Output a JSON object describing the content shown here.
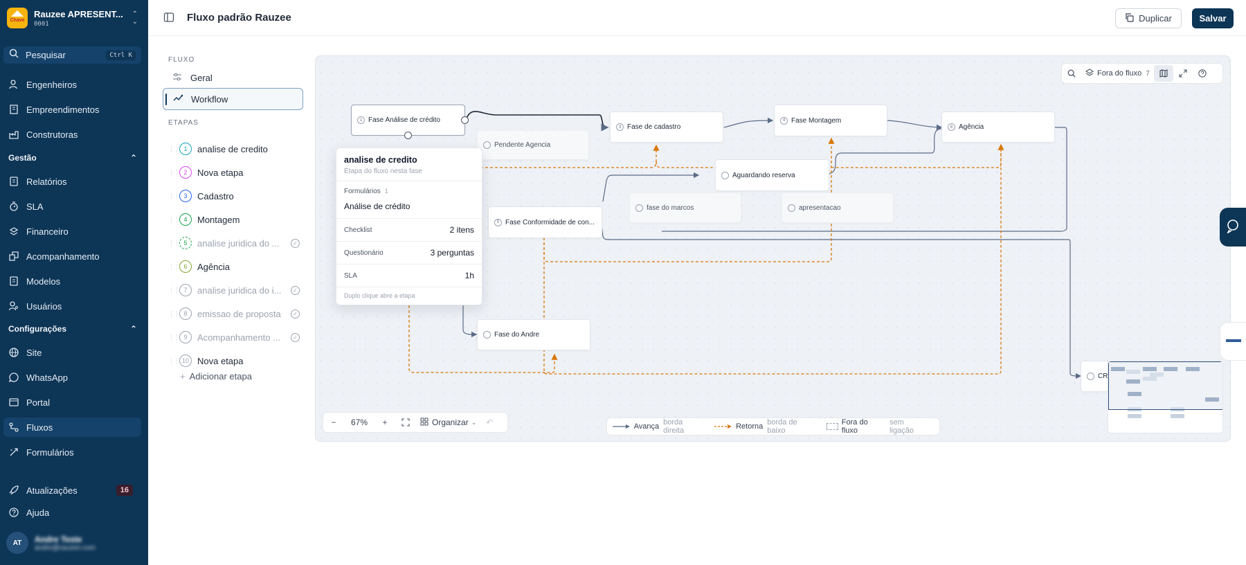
{
  "org": {
    "name": "Rauzee APRESENT...",
    "code": "0001",
    "logo_text": "Chave",
    "logo_color": "#f6b40e"
  },
  "search": {
    "label": "Pesquisar",
    "shortcut": "Ctrl K"
  },
  "nav": {
    "items_top": [
      {
        "label": "Engenheiros",
        "icon": "user-gear-icon"
      },
      {
        "label": "Empreendimentos",
        "icon": "building-icon"
      },
      {
        "label": "Construtoras",
        "icon": "factory-icon"
      }
    ],
    "gestao": {
      "title": "Gestão",
      "items": [
        {
          "label": "Relatórios",
          "icon": "report-icon"
        },
        {
          "label": "SLA",
          "icon": "timer-icon"
        },
        {
          "label": "Financeiro",
          "icon": "money-icon"
        },
        {
          "label": "Acompanhamento",
          "icon": "tracking-icon"
        },
        {
          "label": "Modelos",
          "icon": "document-icon"
        },
        {
          "label": "Usuários",
          "icon": "users-icon"
        }
      ]
    },
    "config": {
      "title": "Configurações",
      "items": [
        {
          "label": "Site",
          "icon": "globe-icon"
        },
        {
          "label": "WhatsApp",
          "icon": "whatsapp-icon"
        },
        {
          "label": "Portal",
          "icon": "portal-icon"
        },
        {
          "label": "Fluxos",
          "icon": "flow-icon"
        },
        {
          "label": "Formulários",
          "icon": "form-icon"
        }
      ]
    },
    "updates": {
      "label": "Atualizações",
      "count": "16"
    },
    "help": {
      "label": "Ajuda"
    }
  },
  "user": {
    "initials": "AT",
    "name": "Andre Teste",
    "email": "andre@rauzee.com"
  },
  "header": {
    "title": "Fluxo padrão Rauzee",
    "duplicate": "Duplicar",
    "save": "Salvar"
  },
  "panel": {
    "flow_label": "FLUXO",
    "general": "Geral",
    "workflow": "Workflow",
    "stages_label": "ETAPAS",
    "stages": [
      {
        "n": "1",
        "label": "analise de credito",
        "color": "#14a3b8",
        "muted": false,
        "dashed": false,
        "check": false
      },
      {
        "n": "2",
        "label": "Nova etapa",
        "color": "#d946ef",
        "muted": false,
        "dashed": false,
        "check": false
      },
      {
        "n": "3",
        "label": "Cadastro",
        "color": "#2563eb",
        "muted": false,
        "dashed": false,
        "check": false
      },
      {
        "n": "4",
        "label": "Montagem",
        "color": "#16a34a",
        "muted": false,
        "dashed": false,
        "check": false
      },
      {
        "n": "5",
        "label": "analise juridica do ...",
        "color": "#16a34a",
        "muted": true,
        "dashed": true,
        "check": true
      },
      {
        "n": "6",
        "label": "Agência",
        "color": "#84a534",
        "muted": false,
        "dashed": false,
        "check": false
      },
      {
        "n": "7",
        "label": "analise juridica do i...",
        "color": "#9ca3af",
        "muted": true,
        "dashed": false,
        "check": true
      },
      {
        "n": "8",
        "label": "emissao de proposta",
        "color": "#9ca3af",
        "muted": true,
        "dashed": false,
        "check": true
      },
      {
        "n": "9",
        "label": "Acompanhamento ...",
        "color": "#9ca3af",
        "muted": true,
        "dashed": false,
        "check": true
      },
      {
        "n": "10",
        "label": "Nova etapa",
        "color": "#9ca3af",
        "muted": false,
        "dashed": false,
        "check": false
      }
    ],
    "add_stage": "Adicionar etapa"
  },
  "canvas": {
    "nodes": {
      "analise": "Fase Análise de crédito",
      "cadastro": "Fase de cadastro",
      "montagem": "Fase Montagem",
      "agencia": "Agência",
      "aguardando": "Aguardando reserva",
      "conformidade": "Fase Conformidade de con...",
      "andre": "Fase do Andre",
      "cr": "CR"
    },
    "ghost_nodes": {
      "pendente": "Pendente Agencia",
      "marcos": "fase do marcos",
      "apresentacao": "apresentacao"
    },
    "toolbar": {
      "ghost_label": "Fora do fluxo",
      "ghost_count": "7"
    },
    "zoom": {
      "level": "67%",
      "organize": "Organizar"
    },
    "legend": {
      "advance": "Avança",
      "advance_sub": "borda direita",
      "return": "Retorna",
      "return_sub": "borda de baixo",
      "outside": "Fora do fluxo",
      "outside_sub": "sem ligação"
    },
    "colors": {
      "advance": "#5b6b86",
      "return": "#d97706"
    },
    "popover": {
      "title": "analise de credito",
      "subtitle": "Etapa do fluxo nesta fase",
      "forms_label": "Formulários",
      "forms_count": "1",
      "form_name": "Análise de crédito",
      "checklist_label": "Checklist",
      "checklist_value": "2 itens",
      "quest_label": "Questionário",
      "quest_value": "3 perguntas",
      "sla_label": "SLA",
      "sla_value": "1h",
      "footer": "Duplo clique abre a etapa"
    }
  }
}
